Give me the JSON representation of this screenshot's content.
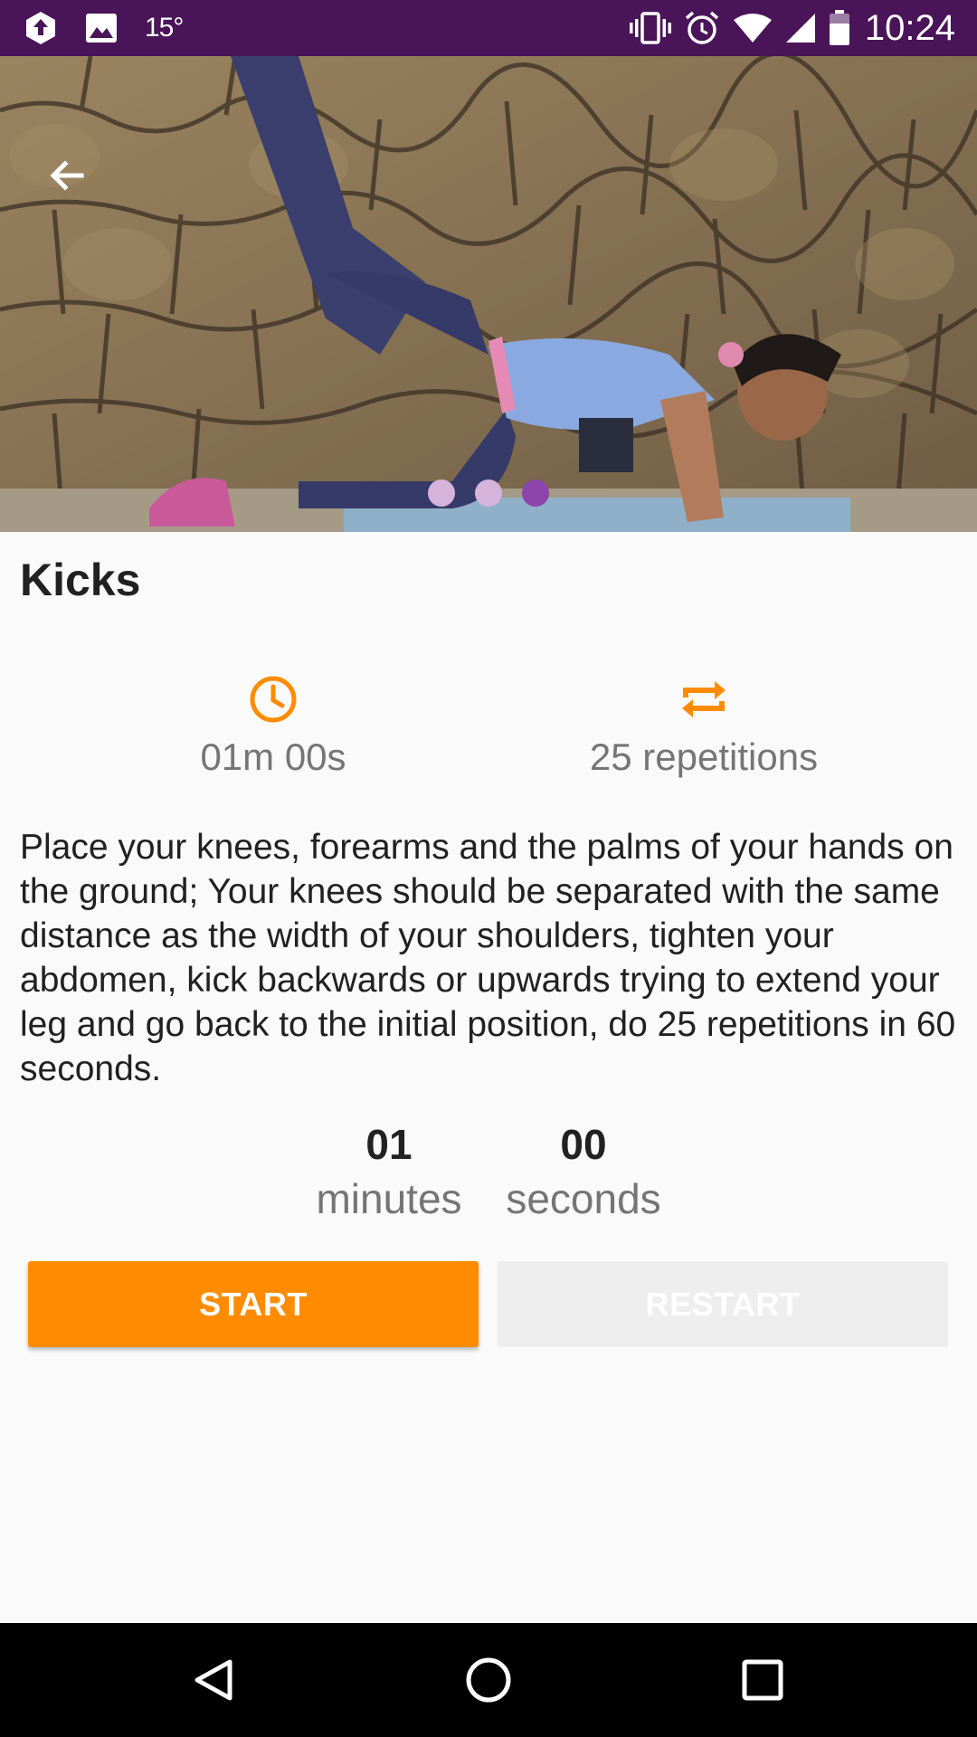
{
  "status_bar": {
    "temperature": "15°",
    "time": "10:24",
    "icons_left": [
      "upload-notification-icon",
      "image-notification-icon"
    ],
    "icons_right": [
      "vibrate-icon",
      "alarm-icon",
      "wifi-icon",
      "signal-icon",
      "battery-icon"
    ]
  },
  "hero": {
    "back_icon": "arrow-left-icon",
    "carousel": {
      "count": 3,
      "active_index": 2
    }
  },
  "exercise": {
    "title": "Kicks",
    "duration": "01m 00s",
    "duration_icon": "clock-icon",
    "repetitions": "25 repetitions",
    "repetitions_icon": "repeat-icon",
    "description": "Place your knees, forearms and the palms of your hands on the ground; Your knees should be separated with the same distance as the width of your shoulders, tighten your abdomen, kick backwards or upwards trying to extend your leg and go back to the initial position, do 25 repetitions in 60 seconds."
  },
  "timer": {
    "minutes_value": "01",
    "minutes_label": "minutes",
    "seconds_value": "00",
    "seconds_label": "seconds"
  },
  "buttons": {
    "start_label": "START",
    "restart_label": "RESTART"
  },
  "nav": {
    "back_icon": "nav-back-icon",
    "home_icon": "nav-home-icon",
    "recents_icon": "nav-recents-icon"
  },
  "colors": {
    "status_bar": "#4a1458",
    "accent_orange": "#ff8c00",
    "dot_active": "#8e44ad",
    "dot_inactive": "#d6b3da"
  }
}
